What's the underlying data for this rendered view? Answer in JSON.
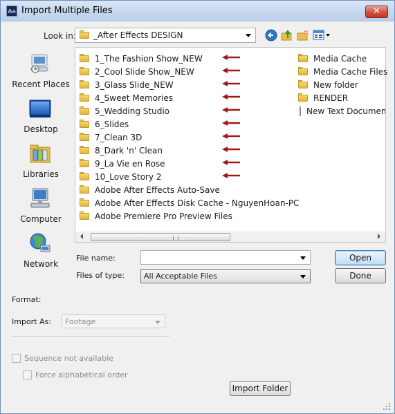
{
  "window": {
    "app_icon_text": "Ae",
    "title": "Import Multiple Files",
    "close_glyph": "✕"
  },
  "lookin": {
    "label": "Look in:",
    "value": "_After Effects DESIGN"
  },
  "toolbar": {
    "icons": [
      "back-icon",
      "up-folder-icon",
      "new-folder-icon",
      "view-menu-icon"
    ]
  },
  "places": [
    {
      "label": "Recent Places",
      "icon": "recent-places-icon"
    },
    {
      "label": "Desktop",
      "icon": "desktop-icon"
    },
    {
      "label": "Libraries",
      "icon": "libraries-icon"
    },
    {
      "label": "Computer",
      "icon": "computer-icon"
    },
    {
      "label": "Network",
      "icon": "network-icon"
    }
  ],
  "files_left": [
    {
      "name": "1_The Fashion Show_NEW",
      "type": "folder",
      "arrow": true
    },
    {
      "name": "2_Cool Slide Show_NEW",
      "type": "folder",
      "arrow": true
    },
    {
      "name": "3_Glass Slide_NEW",
      "type": "folder",
      "arrow": true
    },
    {
      "name": "4_Sweet Memories",
      "type": "folder",
      "arrow": true
    },
    {
      "name": "5_Wedding Studio",
      "type": "folder",
      "arrow": true
    },
    {
      "name": "6_Slides",
      "type": "folder",
      "arrow": true
    },
    {
      "name": "7_Clean 3D",
      "type": "folder",
      "arrow": true
    },
    {
      "name": "8_Dark 'n' Clean",
      "type": "folder",
      "arrow": true
    },
    {
      "name": "9_La Vie en Rose",
      "type": "folder",
      "arrow": true
    },
    {
      "name": "10_Love Story 2",
      "type": "folder",
      "arrow": true
    },
    {
      "name": "Adobe After Effects Auto-Save",
      "type": "folder",
      "arrow": false
    },
    {
      "name": "Adobe After Effects Disk Cache - NguyenHoan-PC",
      "type": "folder",
      "arrow": false
    },
    {
      "name": "Adobe Premiere Pro Preview Files",
      "type": "folder",
      "arrow": false
    }
  ],
  "files_right": [
    {
      "name": "Media Cache",
      "type": "folder"
    },
    {
      "name": "Media Cache Files",
      "type": "folder"
    },
    {
      "name": "New folder",
      "type": "folder"
    },
    {
      "name": "RENDER",
      "type": "folder"
    },
    {
      "name": "New Text Documen",
      "type": "text-document"
    }
  ],
  "fields": {
    "file_name_label": "File name:",
    "file_name_value": "",
    "files_of_type_label": "Files of type:",
    "files_of_type_value": "All Acceptable Files"
  },
  "buttons": {
    "open": "Open",
    "done": "Done",
    "import_folder": "Import Folder"
  },
  "options": {
    "format_label": "Format:",
    "import_as_label": "Import As:",
    "import_as_value": "Footage",
    "sequence_label": "Sequence not available",
    "force_alpha_label": "Force alphabetical order"
  },
  "colors": {
    "annotation_arrow": "#a01818",
    "close_button": "#c8402c",
    "primary_button_border": "#3c7fb1"
  }
}
